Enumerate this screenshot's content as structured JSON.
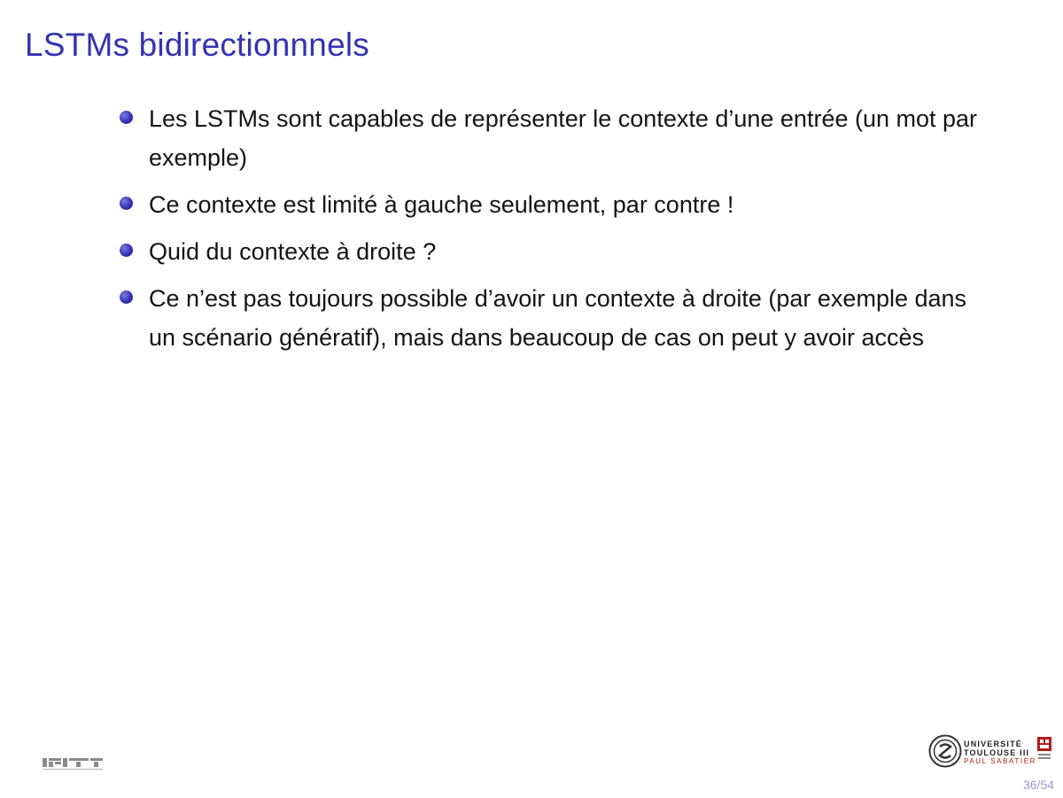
{
  "slide": {
    "title": "LSTMs bidirectionnnels",
    "bullets": [
      "Les LSTMs sont capables de représenter le contexte d’une entrée (un mot par exemple)",
      "Ce contexte est limité à gauche seulement, par contre !",
      "Quid du contexte à droite ?",
      "Ce n’est pas toujours possible d’avoir un contexte à droite (par exemple dans un scénario génératif), mais dans beaucoup de cas on peut y avoir accès"
    ]
  },
  "footer": {
    "lab_logo": "IRIT",
    "university_logo": {
      "line1": "UNIVERSITÉ",
      "line2": "TOULOUSE III",
      "line3": "PAUL SABATIER"
    },
    "page_number": "36/54"
  },
  "colors": {
    "title": "#3333b3",
    "bullet": "#3333b3",
    "text": "#141414",
    "page_number": "#9a9ad6"
  }
}
